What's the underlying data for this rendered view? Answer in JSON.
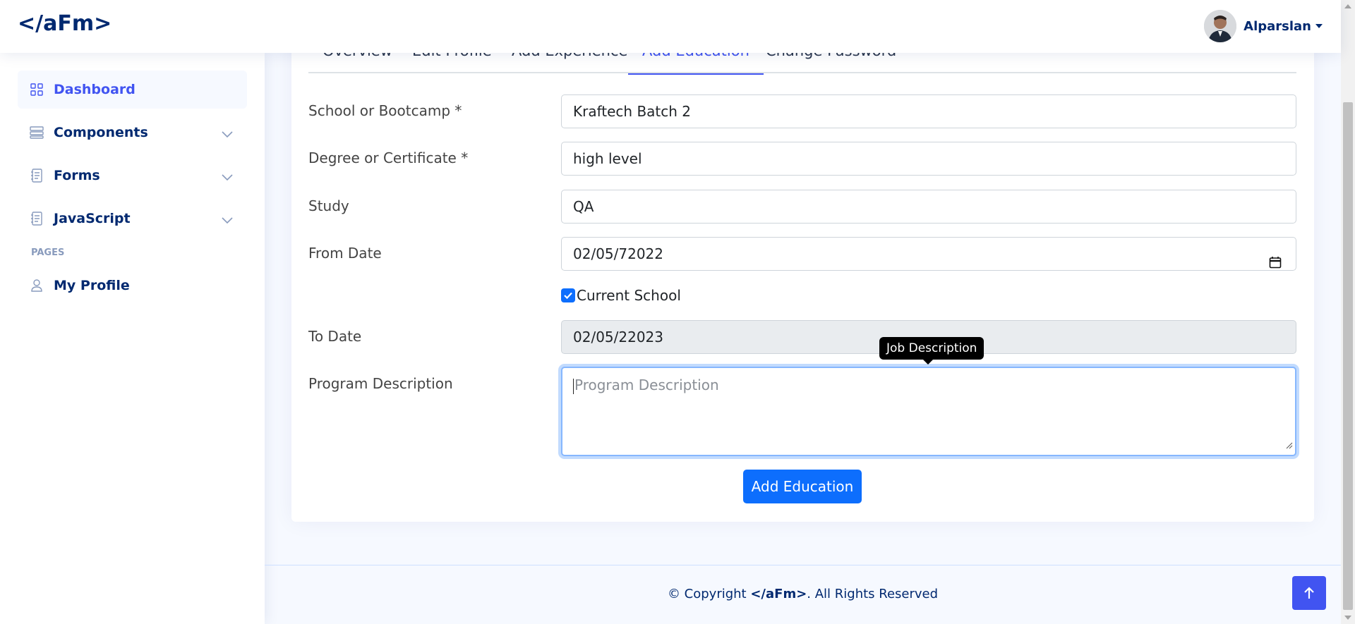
{
  "header": {
    "logo": "</aFm>",
    "profile_name": "Alparslan"
  },
  "sidebar": {
    "items": [
      {
        "label": "Dashboard",
        "icon": "grid-icon"
      },
      {
        "label": "Components",
        "icon": "menu-button-icon"
      },
      {
        "label": "Forms",
        "icon": "journal-text-icon"
      },
      {
        "label": "JavaScript",
        "icon": "journal-code-icon"
      }
    ],
    "pages_heading": "PAGES",
    "profile_item": {
      "label": "My Profile",
      "icon": "person-icon"
    }
  },
  "tabs": [
    {
      "label": "Overview"
    },
    {
      "label": "Edit Profile"
    },
    {
      "label": "Add Experience"
    },
    {
      "label": "Add Education",
      "active": true
    },
    {
      "label": "Change Password"
    }
  ],
  "form": {
    "school_label": "School or Bootcamp *",
    "school_value": "Kraftech Batch 2",
    "degree_label": "Degree or Certificate *",
    "degree_value": "high level",
    "study_label": "Study",
    "study_value": "QA",
    "from_label": "From Date",
    "from_value": "02/05/72022",
    "current_label": "Current School",
    "current_checked": true,
    "to_label": "To Date",
    "to_value": "02/05/22023",
    "description_label": "Program Description",
    "description_placeholder": "Program Description",
    "tooltip": "Job Description",
    "submit_label": "Add Education"
  },
  "footer": {
    "prefix": "© Copyright ",
    "brand": "</aFm>",
    "suffix": ". All Rights Reserved"
  },
  "colors": {
    "brand": "#012970",
    "accent": "#4154f1",
    "primary_button": "#0d6efd"
  }
}
